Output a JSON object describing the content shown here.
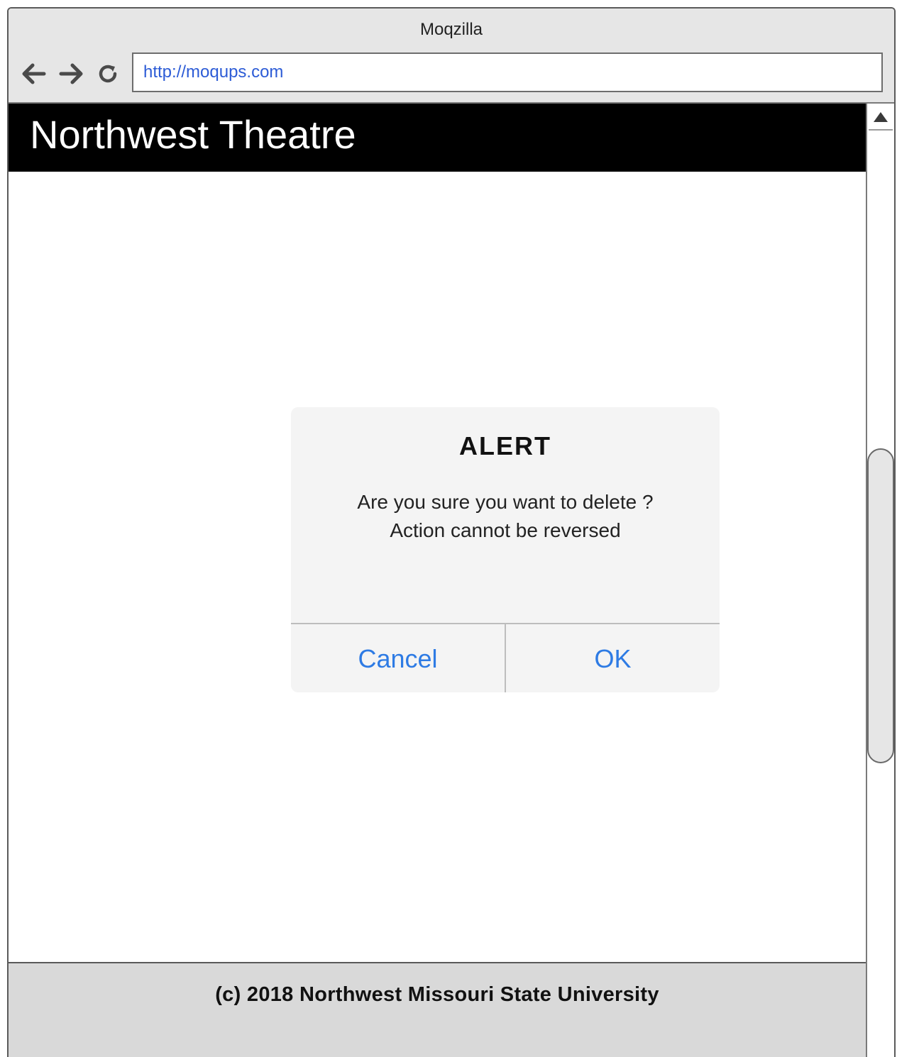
{
  "browser": {
    "window_title": "Moqzilla",
    "address": "http://moqups.com",
    "icons": {
      "back": "arrow-left-icon",
      "forward": "arrow-right-icon",
      "reload": "reload-icon",
      "scroll_up": "triangle-up-icon"
    }
  },
  "site": {
    "title": "Northwest Theatre",
    "footer": "(c) 2018 Northwest Missouri State University"
  },
  "dialog": {
    "title": "ALERT",
    "message_line1": "Are you sure you want to delete ?",
    "message_line2": "Action cannot be reversed",
    "cancel_label": "Cancel",
    "ok_label": "OK"
  },
  "colors": {
    "header_bg": "#000000",
    "footer_bg": "#d9d9d9",
    "dialog_bg": "#f4f4f4",
    "button_text": "#2e7be4",
    "link_text": "#2d5cd6"
  }
}
